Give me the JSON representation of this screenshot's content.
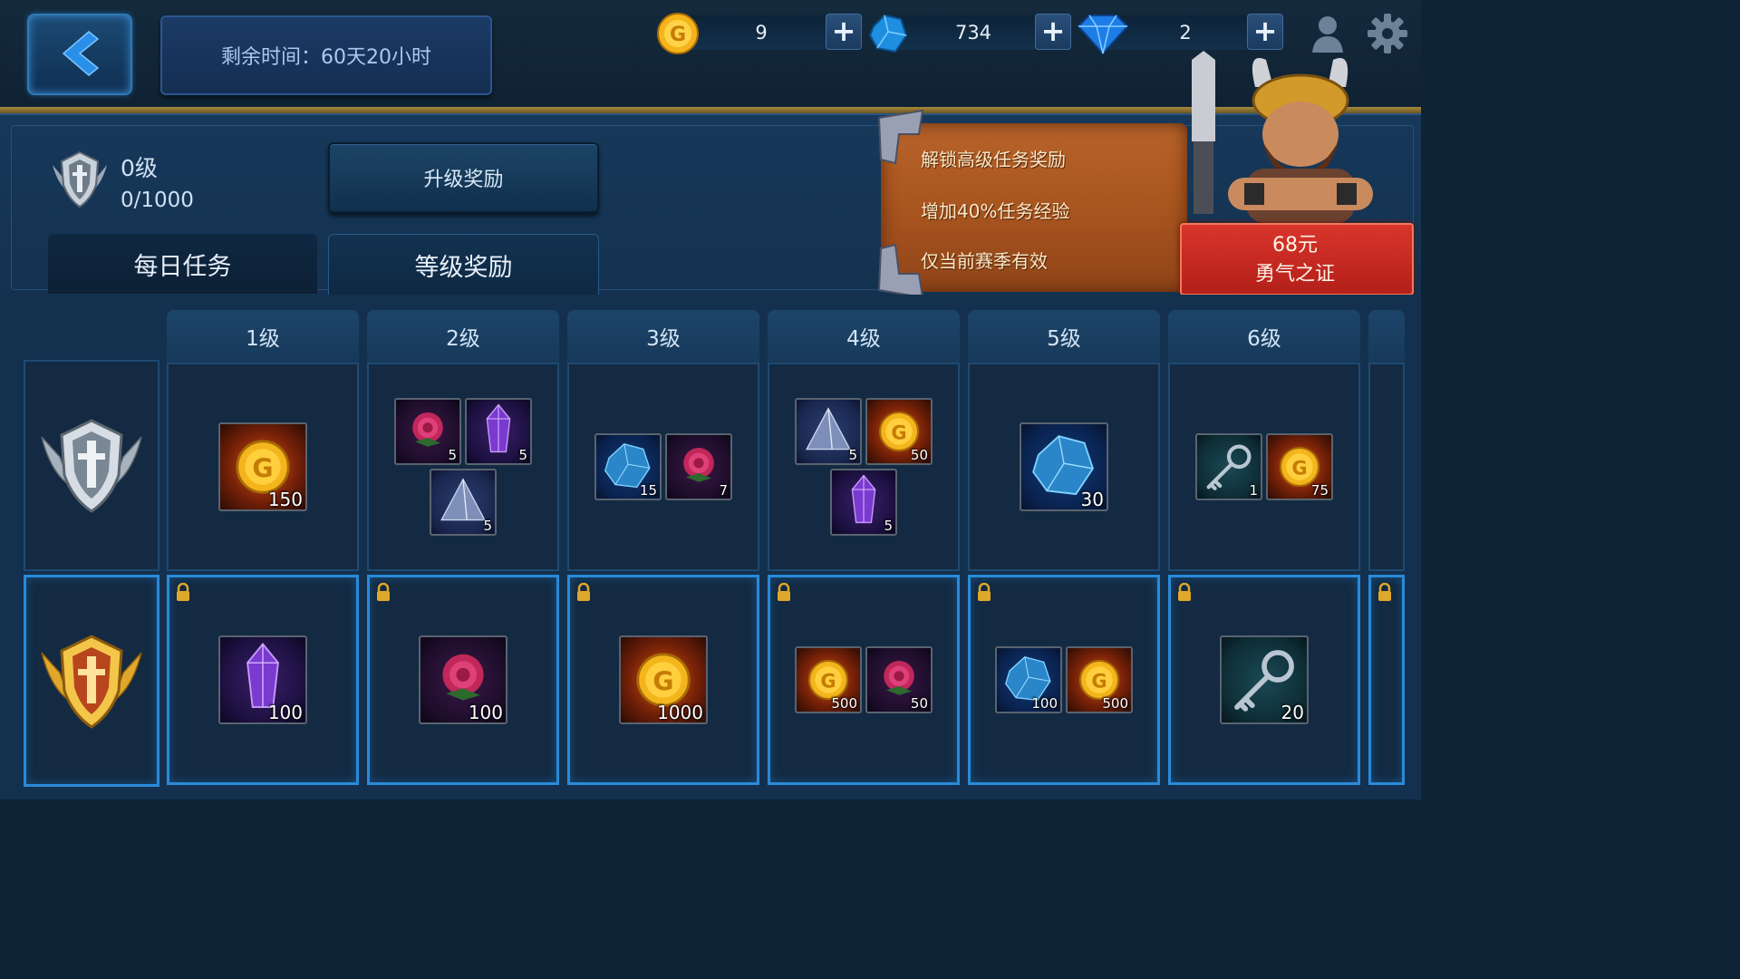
{
  "header": {
    "timer": "剩余时间：60天20小时",
    "currencies": [
      {
        "icon": "gold-coin-icon",
        "value": "9"
      },
      {
        "icon": "blue-gem-icon",
        "value": "734"
      },
      {
        "icon": "diamond-icon",
        "value": "2"
      }
    ],
    "plus_label": "+"
  },
  "player": {
    "level": "0级",
    "exp": "0/1000"
  },
  "upgrade_button": "升级奖励",
  "tabs": [
    "每日任务",
    "等级奖励"
  ],
  "promo": {
    "lines": [
      "解锁高级任务奖励",
      "增加40%任务经验",
      "仅当前赛季有效"
    ],
    "price": "68元",
    "pass_name": "勇气之证"
  },
  "levels": [
    {
      "label": "1级",
      "free": [
        {
          "type": "gold",
          "count": "150"
        }
      ],
      "premium": [
        {
          "type": "crystal",
          "count": "100"
        }
      ]
    },
    {
      "label": "2级",
      "free": [
        {
          "type": "rose",
          "count": "5"
        },
        {
          "type": "crystal",
          "count": "5"
        },
        {
          "type": "pyramid",
          "count": "5"
        }
      ],
      "premium": [
        {
          "type": "rose",
          "count": "100"
        }
      ]
    },
    {
      "label": "3级",
      "free": [
        {
          "type": "ore",
          "count": "15"
        },
        {
          "type": "rose",
          "count": "7"
        }
      ],
      "premium": [
        {
          "type": "gold",
          "count": "1000"
        }
      ]
    },
    {
      "label": "4级",
      "free": [
        {
          "type": "pyramid",
          "count": "5"
        },
        {
          "type": "gold",
          "count": "50"
        },
        {
          "type": "crystal",
          "count": "5"
        }
      ],
      "premium": [
        {
          "type": "gold",
          "count": "500"
        },
        {
          "type": "rose",
          "count": "50"
        }
      ]
    },
    {
      "label": "5级",
      "free": [
        {
          "type": "ore",
          "count": "30"
        }
      ],
      "premium": [
        {
          "type": "ore",
          "count": "100"
        },
        {
          "type": "gold",
          "count": "500"
        }
      ]
    },
    {
      "label": "6级",
      "free": [
        {
          "type": "key",
          "count": "1"
        },
        {
          "type": "gold",
          "count": "75"
        }
      ],
      "premium": [
        {
          "type": "key",
          "count": "20"
        }
      ]
    }
  ],
  "colors": {
    "accent": "#2a8ad8",
    "gold": "#a88a3c",
    "sign": "#b8632b",
    "banner": "#d8352b"
  }
}
